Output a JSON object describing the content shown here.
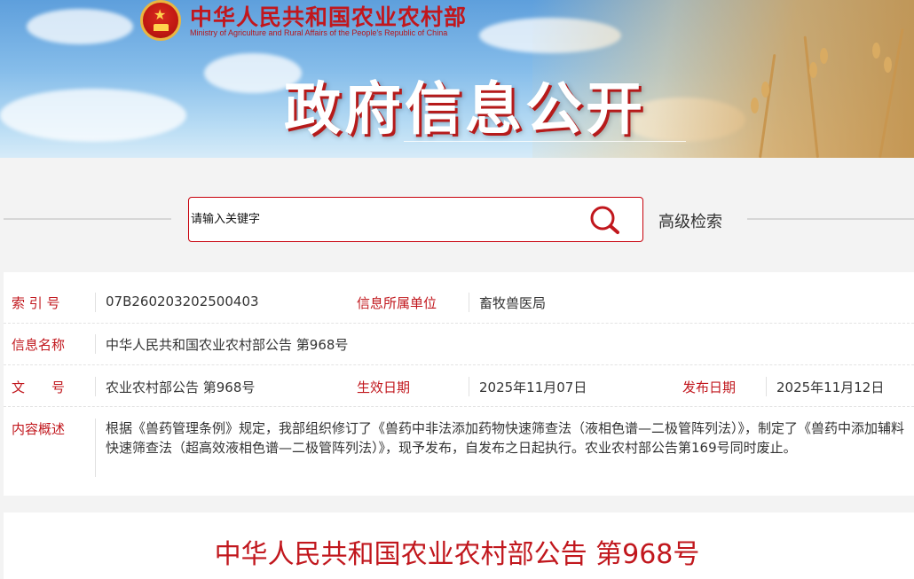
{
  "header": {
    "ministry_cn": "中华人民共和国农业农村部",
    "ministry_en": "Ministry of Agriculture and Rural Affairs of the People's Republic of China",
    "banner_title": "政府信息公开"
  },
  "search": {
    "placeholder": "请输入关键字",
    "advanced_label": "高级检索"
  },
  "info": {
    "index_label": "索 引 号",
    "index_value": "07B260203202500403",
    "unit_label": "信息所属单位",
    "unit_value": "畜牧兽医局",
    "name_label": "信息名称",
    "name_value": "中华人民共和国农业农村部公告 第968号",
    "docno_label": "文　　号",
    "docno_value": "农业农村部公告 第968号",
    "effective_label": "生效日期",
    "effective_value": "2025年11月07日",
    "publish_label": "发布日期",
    "publish_value": "2025年11月12日",
    "summary_label": "内容概述",
    "summary_value": "根据《兽药管理条例》规定，我部组织修订了《兽药中非法添加药物快速筛查法（液相色谱—二极管阵列法）》，制定了《兽药中添加辅料快速筛查法（超高效液相色谱—二极管阵列法）》，现予发布，自发布之日起执行。农业农村部公告第169号同时废止。"
  },
  "article": {
    "title": "中华人民共和国农业农村部公告 第968号"
  },
  "colors": {
    "brand_red": "#c1171d",
    "sky_blue": "#86bdea",
    "wheat_gold": "#d6a862"
  }
}
